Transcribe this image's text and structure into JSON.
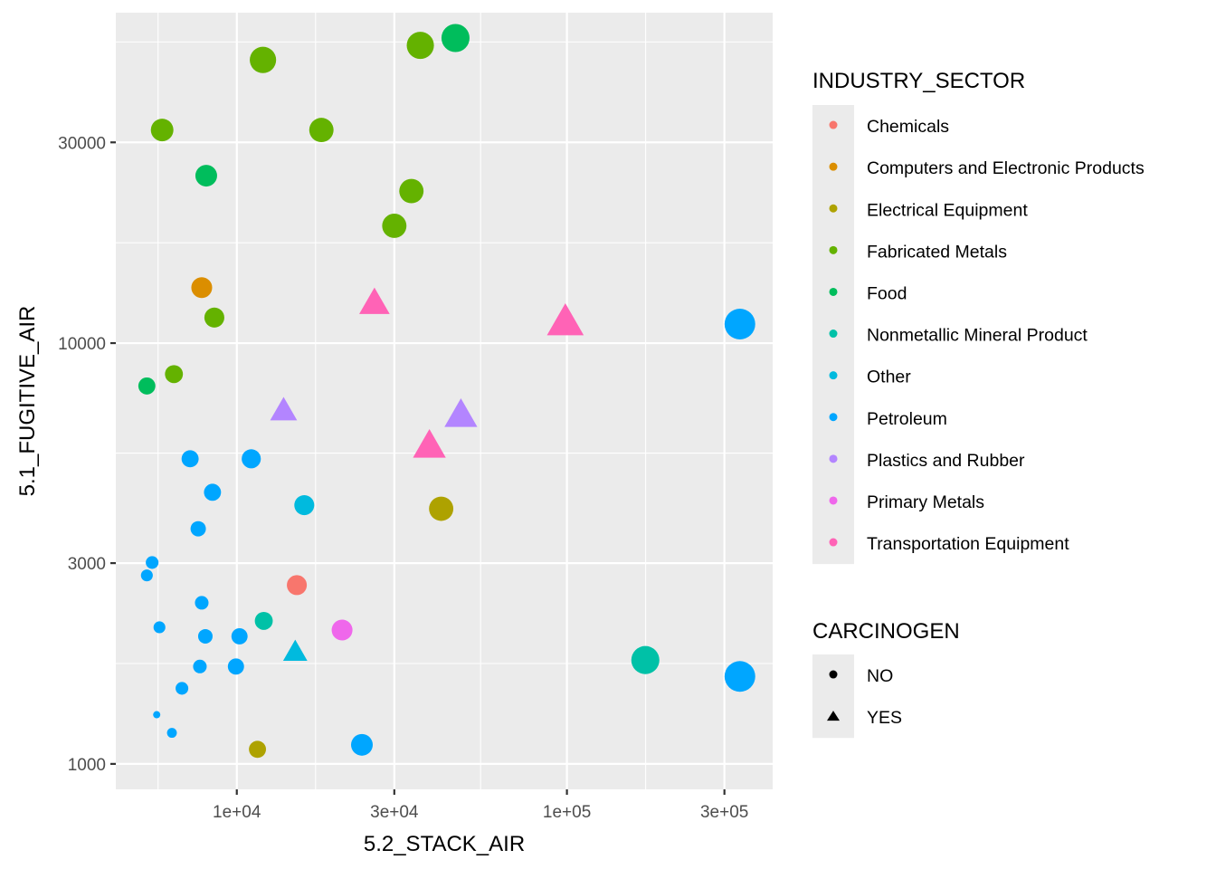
{
  "chart_data": {
    "type": "scatter",
    "title": "",
    "xlabel": "5.2_STACK_AIR",
    "ylabel": "5.1_FUGITIVE_AIR",
    "x_scale": "log10",
    "y_scale": "log10",
    "xlim": [
      4300,
      420000
    ],
    "ylim": [
      870,
      61000
    ],
    "x_ticks": [
      {
        "value": 10000,
        "label": "1e+04"
      },
      {
        "value": 30000,
        "label": "3e+04"
      },
      {
        "value": 100000,
        "label": "1e+05"
      },
      {
        "value": 300000,
        "label": "3e+05"
      }
    ],
    "y_ticks": [
      {
        "value": 1000,
        "label": "1000"
      },
      {
        "value": 3000,
        "label": "3000"
      },
      {
        "value": 10000,
        "label": "10000"
      },
      {
        "value": 30000,
        "label": "30000"
      }
    ],
    "grid": true,
    "background": "#EBEBEB",
    "legend_position": "right",
    "legends": [
      {
        "title": "INDUSTRY_SECTOR",
        "aesthetic": "color",
        "entries": [
          {
            "label": "Chemicals",
            "color": "#F8766D"
          },
          {
            "label": "Computers and Electronic Products",
            "color": "#DB8E00"
          },
          {
            "label": "Electrical Equipment",
            "color": "#AEA200"
          },
          {
            "label": "Fabricated Metals",
            "color": "#64B200"
          },
          {
            "label": "Food",
            "color": "#00BD5C"
          },
          {
            "label": "Nonmetallic Mineral Product",
            "color": "#00C1A7"
          },
          {
            "label": "Other",
            "color": "#00BADE"
          },
          {
            "label": "Petroleum",
            "color": "#00A6FF"
          },
          {
            "label": "Plastics and Rubber",
            "color": "#B385FF"
          },
          {
            "label": "Primary Metals",
            "color": "#EF67EB"
          },
          {
            "label": "Transportation Equipment",
            "color": "#FF63B6"
          }
        ]
      },
      {
        "title": "CARCINOGEN",
        "aesthetic": "shape",
        "entries": [
          {
            "label": "NO",
            "shape": "circle"
          },
          {
            "label": "YES",
            "shape": "triangle"
          }
        ]
      }
    ],
    "points": [
      {
        "sector": "Chemicals",
        "carcinogen": "NO",
        "x": 15200,
        "y": 2660,
        "size": 6.9
      },
      {
        "sector": "Computers and Electronic Products",
        "carcinogen": "NO",
        "x": 7830,
        "y": 13550,
        "size": 7.2
      },
      {
        "sector": "Electrical Equipment",
        "carcinogen": "NO",
        "x": 41600,
        "y": 4040,
        "size": 8.4
      },
      {
        "sector": "Electrical Equipment",
        "carcinogen": "NO",
        "x": 11550,
        "y": 1083,
        "size": 5.9
      },
      {
        "sector": "Fabricated Metals",
        "carcinogen": "NO",
        "x": 5940,
        "y": 32100,
        "size": 7.8
      },
      {
        "sector": "Fabricated Metals",
        "carcinogen": "NO",
        "x": 12000,
        "y": 47100,
        "size": 9.1
      },
      {
        "sector": "Fabricated Metals",
        "carcinogen": "NO",
        "x": 18040,
        "y": 32100,
        "size": 8.4
      },
      {
        "sector": "Fabricated Metals",
        "carcinogen": "NO",
        "x": 35970,
        "y": 51000,
        "size": 9.4
      },
      {
        "sector": "Fabricated Metals",
        "carcinogen": "NO",
        "x": 33800,
        "y": 22980,
        "size": 8.4
      },
      {
        "sector": "Fabricated Metals",
        "carcinogen": "NO",
        "x": 30000,
        "y": 19000,
        "size": 8.4
      },
      {
        "sector": "Fabricated Metals",
        "carcinogen": "NO",
        "x": 8550,
        "y": 11500,
        "size": 6.9
      },
      {
        "sector": "Fabricated Metals",
        "carcinogen": "NO",
        "x": 6450,
        "y": 8440,
        "size": 6.2
      },
      {
        "sector": "Food",
        "carcinogen": "NO",
        "x": 45970,
        "y": 53100,
        "size": 9.7
      },
      {
        "sector": "Food",
        "carcinogen": "NO",
        "x": 8080,
        "y": 25000,
        "size": 7.5
      },
      {
        "sector": "Food",
        "carcinogen": "NO",
        "x": 5340,
        "y": 7910,
        "size": 5.9
      },
      {
        "sector": "Nonmetallic Mineral Product",
        "carcinogen": "NO",
        "x": 12070,
        "y": 2187,
        "size": 6.2
      },
      {
        "sector": "Nonmetallic Mineral Product",
        "carcinogen": "NO",
        "x": 172800,
        "y": 1765,
        "size": 9.7
      },
      {
        "sector": "Other",
        "carcinogen": "NO",
        "x": 16010,
        "y": 4120,
        "size": 6.9
      },
      {
        "sector": "Other",
        "carcinogen": "YES",
        "x": 15030,
        "y": 1837,
        "size": 6.2
      },
      {
        "sector": "Petroleum",
        "carcinogen": "NO",
        "x": 334200,
        "y": 11100,
        "size": 10.6
      },
      {
        "sector": "Petroleum",
        "carcinogen": "NO",
        "x": 334200,
        "y": 1614,
        "size": 10.6
      },
      {
        "sector": "Petroleum",
        "carcinogen": "NO",
        "x": 23930,
        "y": 1110,
        "size": 7.5
      },
      {
        "sector": "Petroleum",
        "carcinogen": "NO",
        "x": 7220,
        "y": 5310,
        "size": 5.9
      },
      {
        "sector": "Petroleum",
        "carcinogen": "NO",
        "x": 11060,
        "y": 5310,
        "size": 6.6
      },
      {
        "sector": "Petroleum",
        "carcinogen": "NO",
        "x": 8440,
        "y": 4420,
        "size": 5.9
      },
      {
        "sector": "Petroleum",
        "carcinogen": "NO",
        "x": 7640,
        "y": 3620,
        "size": 5.3
      },
      {
        "sector": "Petroleum",
        "carcinogen": "NO",
        "x": 5540,
        "y": 3010,
        "size": 4.4
      },
      {
        "sector": "Petroleum",
        "carcinogen": "NO",
        "x": 5340,
        "y": 2805,
        "size": 4.1
      },
      {
        "sector": "Petroleum",
        "carcinogen": "NO",
        "x": 7830,
        "y": 2415,
        "size": 4.7
      },
      {
        "sector": "Petroleum",
        "carcinogen": "NO",
        "x": 5830,
        "y": 2112,
        "size": 4.1
      },
      {
        "sector": "Petroleum",
        "carcinogen": "NO",
        "x": 8030,
        "y": 2010,
        "size": 5.0
      },
      {
        "sector": "Petroleum",
        "carcinogen": "NO",
        "x": 10190,
        "y": 2010,
        "size": 5.6
      },
      {
        "sector": "Petroleum",
        "carcinogen": "NO",
        "x": 7730,
        "y": 1704,
        "size": 4.7
      },
      {
        "sector": "Petroleum",
        "carcinogen": "NO",
        "x": 9940,
        "y": 1704,
        "size": 5.6
      },
      {
        "sector": "Petroleum",
        "carcinogen": "NO",
        "x": 6820,
        "y": 1512,
        "size": 4.4
      },
      {
        "sector": "Petroleum",
        "carcinogen": "NO",
        "x": 5720,
        "y": 1309,
        "size": 2.5
      },
      {
        "sector": "Petroleum",
        "carcinogen": "NO",
        "x": 6360,
        "y": 1185,
        "size": 3.4
      },
      {
        "sector": "Plastics and Rubber",
        "carcinogen": "YES",
        "x": 13860,
        "y": 6880,
        "size": 6.9
      },
      {
        "sector": "Plastics and Rubber",
        "carcinogen": "YES",
        "x": 47730,
        "y": 6710,
        "size": 8.4
      },
      {
        "sector": "Primary Metals",
        "carcinogen": "NO",
        "x": 20840,
        "y": 2080,
        "size": 7.2
      },
      {
        "sector": "Transportation Equipment",
        "carcinogen": "YES",
        "x": 26120,
        "y": 12390,
        "size": 7.8
      },
      {
        "sector": "Transportation Equipment",
        "carcinogen": "YES",
        "x": 98900,
        "y": 11160,
        "size": 9.4
      },
      {
        "sector": "Transportation Equipment",
        "carcinogen": "YES",
        "x": 38320,
        "y": 5670,
        "size": 8.4
      }
    ]
  }
}
